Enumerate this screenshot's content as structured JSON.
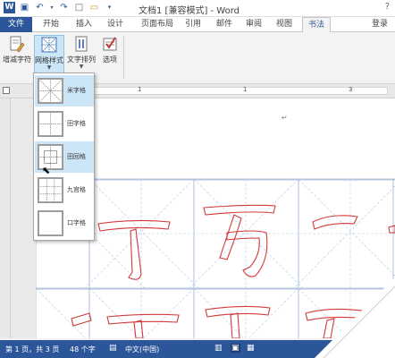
{
  "titlebar": {
    "title": "文档1 [兼容模式] - Word",
    "help": "?"
  },
  "tabs": {
    "file": "文件",
    "home": "开始",
    "insert": "插入",
    "design": "设计",
    "layout": "页面布局",
    "references": "引用",
    "mailings": "邮件",
    "review": "审阅",
    "view": "视图",
    "calligraphy": "书法",
    "login": "登录"
  },
  "ribbon": {
    "add_remove_chars": "增减字符",
    "grid_style": "网格样式",
    "text_arrange": "文字排列",
    "options": "选项"
  },
  "ruler": {
    "n1": "1",
    "n2": "1",
    "n3": "3"
  },
  "dropdown": {
    "items": [
      {
        "label": "米字格"
      },
      {
        "label": "田字格"
      },
      {
        "label": "田回格"
      },
      {
        "label": "九宫格"
      },
      {
        "label": "口字格"
      }
    ]
  },
  "status": {
    "pages": "第 1 页，共 3 页",
    "words": "48 个字",
    "language": "中文(中国)"
  },
  "colors": {
    "accent": "#2b579a",
    "grid_line": "#8aa6d0",
    "char_stroke": "#d23a3a",
    "highlight": "#cde6f7"
  }
}
